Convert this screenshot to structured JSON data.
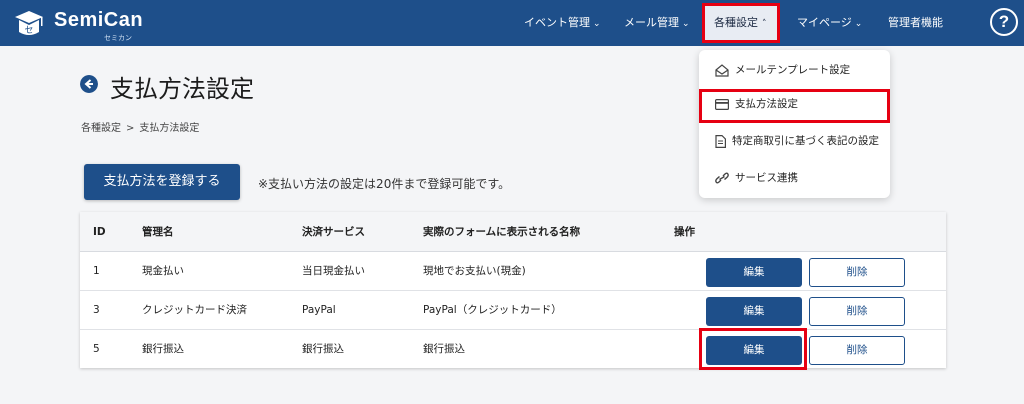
{
  "app": {
    "name": "SemiCan",
    "name_sub": "セミカン"
  },
  "nav": {
    "items": [
      {
        "label": "イベント管理"
      },
      {
        "label": "メール管理"
      },
      {
        "label": "各種設定"
      },
      {
        "label": "マイページ"
      },
      {
        "label": "管理者機能"
      }
    ],
    "help": "?"
  },
  "dropdown": {
    "items": [
      {
        "label": "メールテンプレート設定",
        "icon": "envelope-open-icon"
      },
      {
        "label": "支払方法設定",
        "icon": "credit-card-icon"
      },
      {
        "label": "特定商取引に基づく表記の設定",
        "icon": "document-icon"
      },
      {
        "label": "サービス連携",
        "icon": "link-icon"
      }
    ]
  },
  "page": {
    "title": "支払方法設定",
    "breadcrumb": [
      "各種設定",
      ">",
      "支払方法設定"
    ],
    "register_button": "支払方法を登録する",
    "note": "※支払い方法の設定は20件まで登録可能です。"
  },
  "table": {
    "headers": [
      "ID",
      "管理名",
      "決済サービス",
      "実際のフォームに表示される名称",
      "操作"
    ],
    "rows": [
      {
        "id": "1",
        "name": "現金払い",
        "service": "当日現金払い",
        "display": "現地でお支払い(現金)",
        "edit": "編集",
        "delete": "削除"
      },
      {
        "id": "3",
        "name": "クレジットカード決済",
        "service": "PayPal",
        "display": "PayPal（クレジットカード）",
        "edit": "編集",
        "delete": "削除"
      },
      {
        "id": "5",
        "name": "銀行振込",
        "service": "銀行振込",
        "display": "銀行振込",
        "edit": "編集",
        "delete": "削除"
      }
    ]
  },
  "colors": {
    "brand": "#1e4f8a",
    "highlight": "#e60012"
  }
}
